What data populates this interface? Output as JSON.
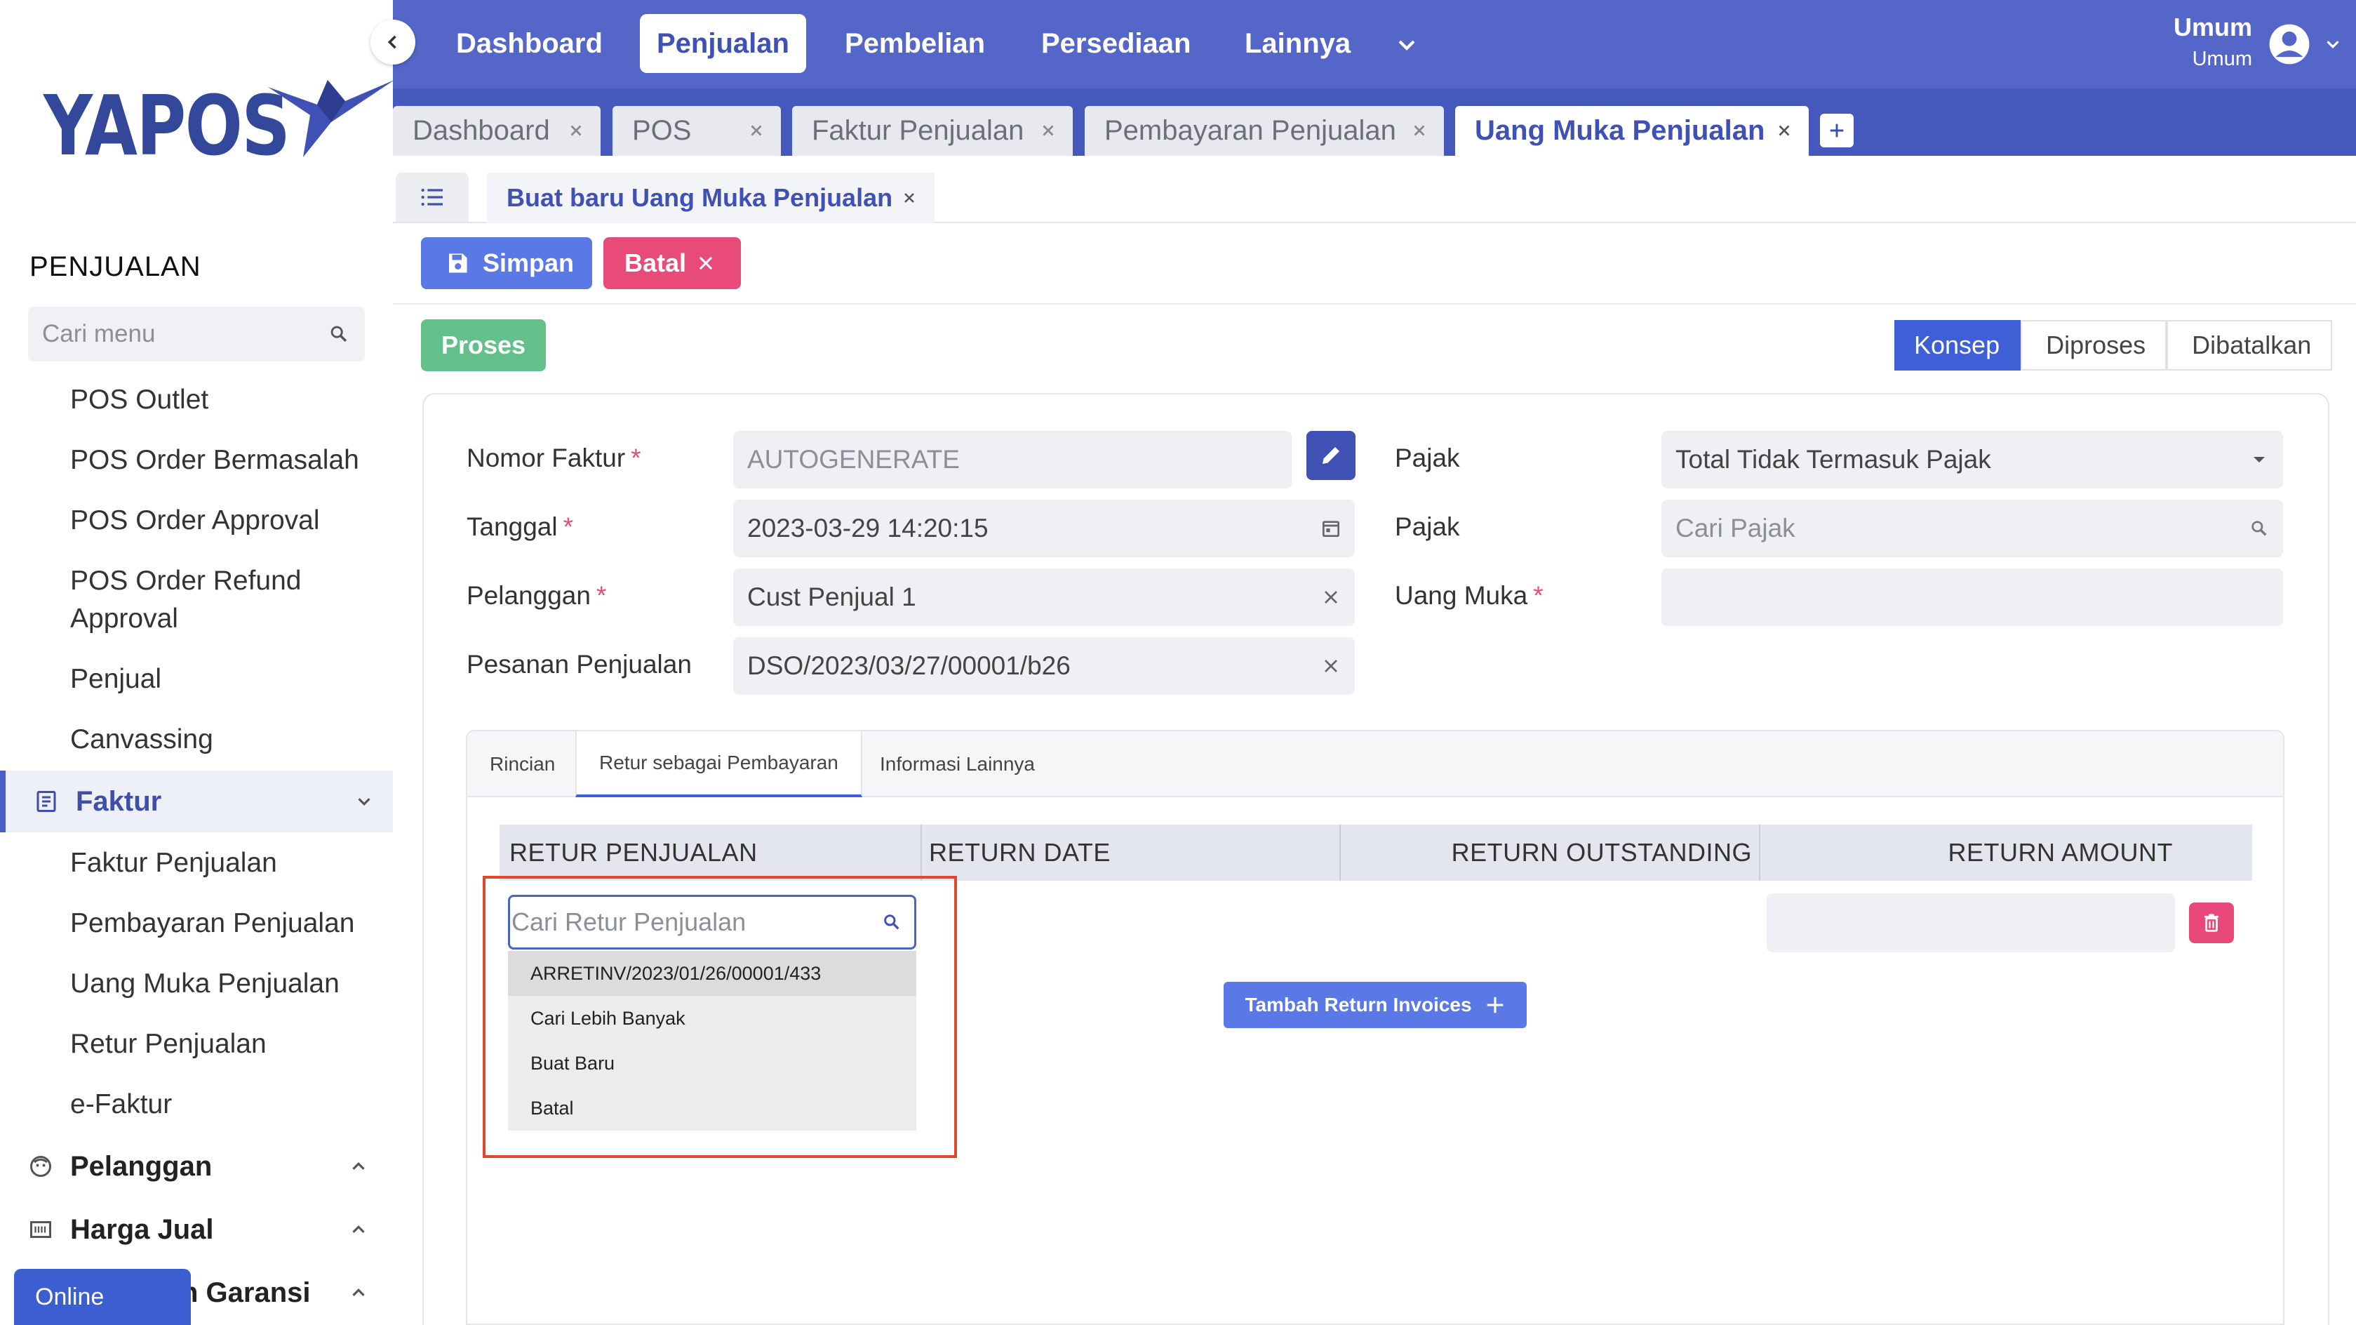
{
  "logo": {
    "text": "YAPOS"
  },
  "sidebar": {
    "section_title": "PENJUALAN",
    "search_placeholder": "Cari menu",
    "items": [
      {
        "label": "POS Outlet"
      },
      {
        "label": "POS Order Bermasalah"
      },
      {
        "label": "POS Order Approval"
      },
      {
        "label": "POS Order Refund Approval"
      },
      {
        "label": "Penjual"
      },
      {
        "label": "Canvassing"
      }
    ],
    "groups": [
      {
        "label": "Faktur",
        "icon": "receipt-icon",
        "expanded": true
      },
      {
        "label": "Pelanggan",
        "icon": "face-icon",
        "expanded": false
      },
      {
        "label": "Harga Jual",
        "icon": "barcode-icon",
        "expanded": false
      },
      {
        "label": "n Garansi",
        "icon": "shield-icon",
        "expanded": false
      }
    ],
    "faktur_items": [
      {
        "label": "Faktur Penjualan"
      },
      {
        "label": "Pembayaran Penjualan"
      },
      {
        "label": "Uang Muka Penjualan"
      },
      {
        "label": "Retur Penjualan"
      },
      {
        "label": "e-Faktur"
      }
    ],
    "online_status": "Online"
  },
  "topnav": {
    "items": [
      {
        "label": "Dashboard",
        "active": false
      },
      {
        "label": "Penjualan",
        "active": true
      },
      {
        "label": "Pembelian",
        "active": false
      },
      {
        "label": "Persediaan",
        "active": false
      },
      {
        "label": "Lainnya",
        "active": false
      }
    ],
    "user": {
      "name": "Umum",
      "role": "Umum"
    }
  },
  "tabs": [
    {
      "label": "Dashboard",
      "active": false
    },
    {
      "label": "POS",
      "active": false
    },
    {
      "label": "Faktur Penjualan",
      "active": false
    },
    {
      "label": "Pembayaran Penjualan",
      "active": false
    },
    {
      "label": "Uang Muka Penjualan",
      "active": true
    }
  ],
  "doc_tab": {
    "title": "Buat baru Uang Muka Penjualan"
  },
  "actions": {
    "save": "Simpan",
    "cancel": "Batal",
    "process": "Proses"
  },
  "status_steps": [
    {
      "label": "Konsep",
      "active": true
    },
    {
      "label": "Diproses",
      "active": false
    },
    {
      "label": "Dibatalkan",
      "active": false
    }
  ],
  "form": {
    "nomor_faktur": {
      "label": "Nomor Faktur",
      "value": "AUTOGENERATE"
    },
    "tanggal": {
      "label": "Tanggal",
      "value": "2023-03-29  14:20:15"
    },
    "pelanggan": {
      "label": "Pelanggan",
      "value": "Cust Penjual 1"
    },
    "pesanan": {
      "label": "Pesanan Penjualan",
      "value": "DSO/2023/03/27/00001/b26"
    },
    "pajak_type": {
      "label": "Pajak",
      "value": "Total Tidak Termasuk Pajak"
    },
    "pajak": {
      "label": "Pajak",
      "placeholder": "Cari Pajak"
    },
    "uang_muka": {
      "label": "Uang Muka",
      "value": ""
    },
    "required_mark": "*"
  },
  "inner_tabs": [
    {
      "label": "Rincian",
      "active": false
    },
    {
      "label": "Retur sebagai Pembayaran",
      "active": true
    },
    {
      "label": "Informasi Lainnya",
      "active": false
    }
  ],
  "table": {
    "headers": [
      "RETUR PENJUALAN",
      "RETURN DATE",
      "RETURN OUTSTANDING",
      "RETURN AMOUNT"
    ],
    "search_placeholder": "Cari Retur Penjualan",
    "dropdown_options": [
      "ARRETINV/2023/01/26/00001/433",
      "Cari Lebih Banyak",
      "Buat Baru",
      "Batal"
    ],
    "add_button": "Tambah Return Invoices"
  },
  "colors": {
    "primary": "#5466c8",
    "accent_blue": "#3f5fd6",
    "danger": "#e84a7a",
    "success": "#64c08a",
    "highlight": "#e2462f"
  }
}
